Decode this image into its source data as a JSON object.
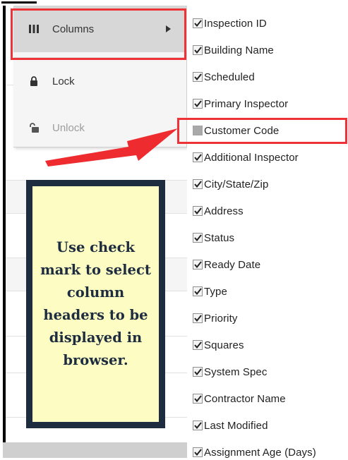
{
  "context_menu": {
    "items": [
      {
        "label": "Columns",
        "icon": "columns-icon",
        "enabled": true,
        "has_submenu": true,
        "highlighted": true
      },
      {
        "label": "Lock",
        "icon": "lock-icon",
        "enabled": true,
        "has_submenu": false
      },
      {
        "label": "Unlock",
        "icon": "unlock-icon",
        "enabled": false,
        "has_submenu": false
      }
    ]
  },
  "column_chooser": {
    "items": [
      {
        "label": "Inspection ID",
        "checked": true
      },
      {
        "label": "Building Name",
        "checked": true
      },
      {
        "label": "Scheduled",
        "checked": true
      },
      {
        "label": "Primary Inspector",
        "checked": true
      },
      {
        "label": "Customer Code",
        "checked": false,
        "highlighted": true
      },
      {
        "label": "Additional Inspector",
        "checked": true
      },
      {
        "label": "City/State/Zip",
        "checked": true
      },
      {
        "label": "Address",
        "checked": true
      },
      {
        "label": "Status",
        "checked": true
      },
      {
        "label": "Ready Date",
        "checked": true
      },
      {
        "label": "Type",
        "checked": true
      },
      {
        "label": "Priority",
        "checked": true
      },
      {
        "label": "Squares",
        "checked": true
      },
      {
        "label": "System Spec",
        "checked": true
      },
      {
        "label": "Contractor Name",
        "checked": true
      },
      {
        "label": "Last Modified",
        "checked": true
      },
      {
        "label": "Assignment Age (Days)",
        "checked": true
      }
    ]
  },
  "callout": {
    "text": "Use check mark to select column headers to be displayed in browser."
  },
  "colors": {
    "highlight": "#ee3338",
    "callout_border": "#1d2d3f",
    "callout_background": "#fdfcc2"
  }
}
